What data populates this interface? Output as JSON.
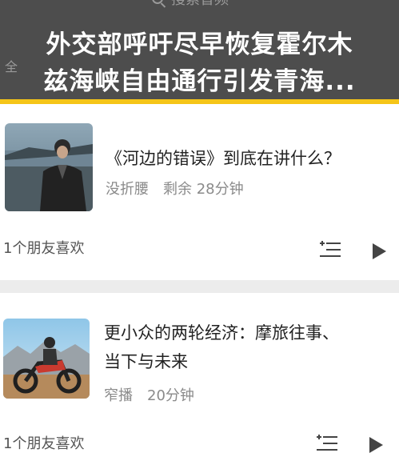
{
  "search": {
    "placeholder": "搜索音频",
    "icon": "search-icon"
  },
  "side_tab": "全",
  "headline": {
    "line1": "外交部呼吁尽早恢复霍尔木",
    "line2": "兹海峡自由通行引发青海..."
  },
  "colors": {
    "accent": "#f5c518",
    "overlay": "#4d4d4d"
  },
  "items": [
    {
      "title": "《河边的错误》到底在讲什么？",
      "author": "没折腰",
      "remaining": "剩余 28分钟",
      "likes": "1个朋友喜欢"
    },
    {
      "title_line1": "更小众的两轮经济：摩旅往事、",
      "title_line2": "当下与未来",
      "author": "窄播",
      "duration": "20分钟",
      "likes": "1个朋友喜欢"
    }
  ]
}
